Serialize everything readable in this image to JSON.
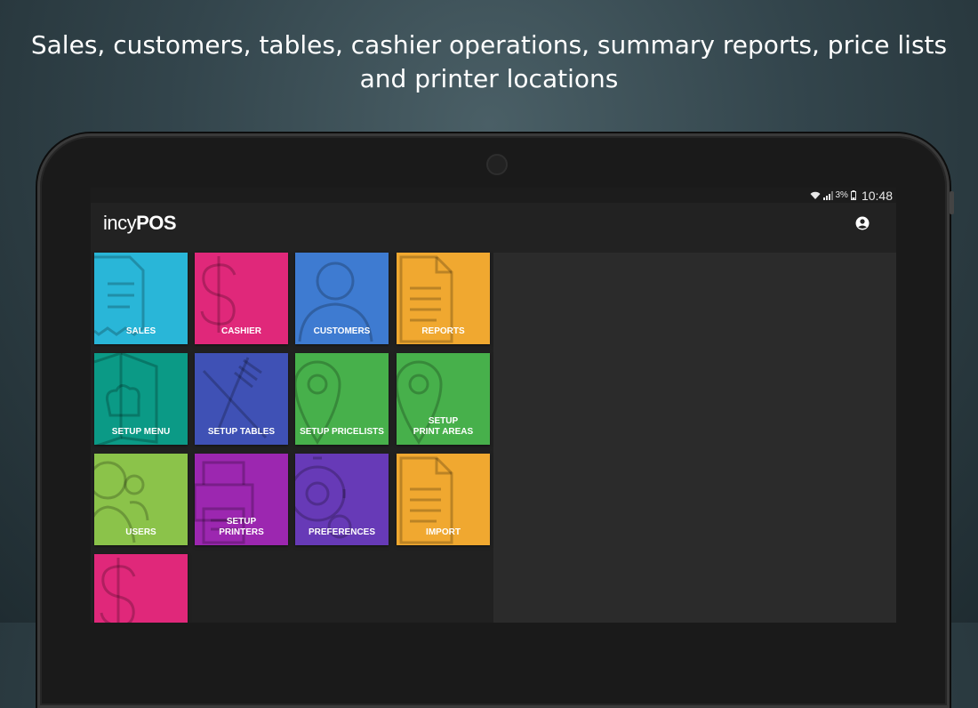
{
  "headline": {
    "line1": "Sales, customers, tables, cashier operations, summary reports, price lists",
    "line2": "and printer locations"
  },
  "status_bar": {
    "battery_percent": "3%",
    "time": "10:48",
    "icons": [
      "wifi-icon",
      "signal-icon",
      "battery-icon"
    ]
  },
  "app": {
    "logo_light": "incy",
    "logo_bold": "POS",
    "account_icon": "account-circle-icon"
  },
  "tiles": [
    {
      "label": "SALES",
      "color": "#29b6d8",
      "icon": "receipt-icon"
    },
    {
      "label": "CASHIER",
      "color": "#e0287a",
      "icon": "dollar-icon"
    },
    {
      "label": "CUSTOMERS",
      "color": "#3e7bd1",
      "icon": "person-icon"
    },
    {
      "label": "REPORTS",
      "color": "#f0a830",
      "icon": "document-icon"
    },
    {
      "label": "SETUP MENU",
      "color": "#0b9a86",
      "icon": "menu-book-icon"
    },
    {
      "label": "SETUP TABLES",
      "color": "#3f51b5",
      "icon": "cutlery-icon"
    },
    {
      "label": "SETUP PRICELISTS",
      "color": "#47b04b",
      "icon": "location-pin-icon"
    },
    {
      "label": "SETUP\nPRINT AREAS",
      "color": "#47b04b",
      "icon": "location-pin-icon"
    },
    {
      "label": "USERS",
      "color": "#8bc34a",
      "icon": "users-icon"
    },
    {
      "label": "SETUP\nPRINTERS",
      "color": "#9c27b0",
      "icon": "printer-icon"
    },
    {
      "label": "PREFERENCES",
      "color": "#673ab7",
      "icon": "gear-icon"
    },
    {
      "label": "IMPORT",
      "color": "#f0a830",
      "icon": "document-icon"
    },
    {
      "label": "",
      "color": "#e0287a",
      "icon": "dollar-icon"
    }
  ]
}
